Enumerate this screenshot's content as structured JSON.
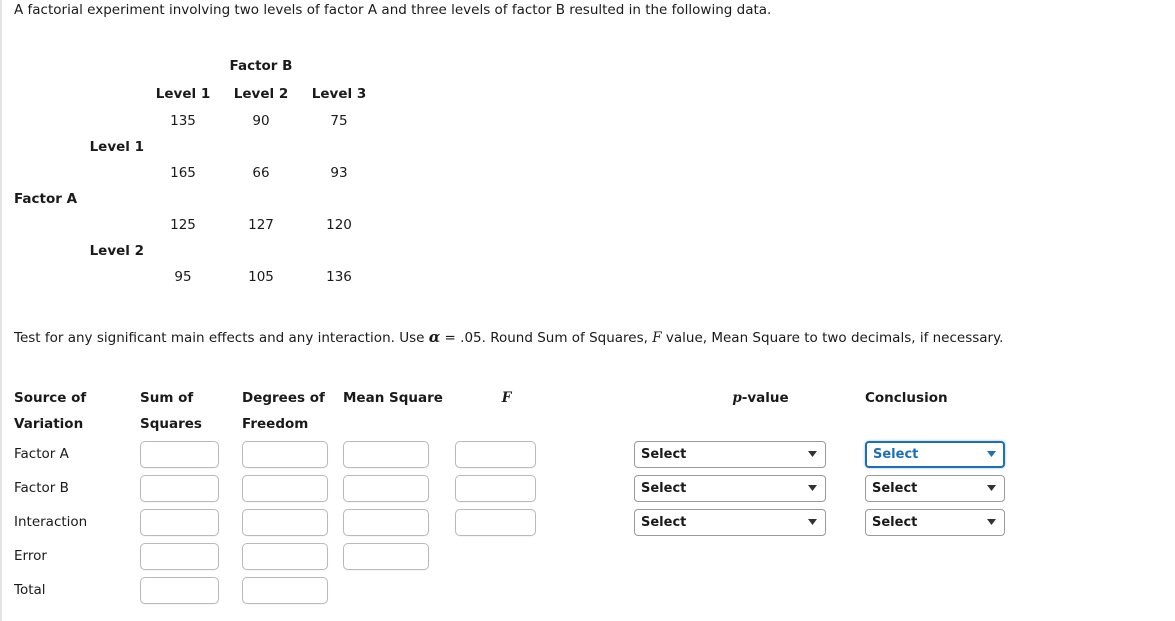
{
  "intro": "A factorial experiment involving two levels of factor A and three levels of factor B resulted in the following data.",
  "data_table": {
    "factor_b_header": "Factor B",
    "b_levels": [
      "Level 1",
      "Level 2",
      "Level 3"
    ],
    "factor_a_label": "Factor A",
    "a_levels": [
      "Level 1",
      "Level 2"
    ],
    "rows": [
      [
        "135",
        "90",
        "75"
      ],
      [
        "165",
        "66",
        "93"
      ],
      [
        "125",
        "127",
        "120"
      ],
      [
        "95",
        "105",
        "136"
      ]
    ]
  },
  "prompt": {
    "part1": "Test for any significant main effects and any interaction. Use ",
    "alpha": "α",
    "part2": " = .05. Round Sum of Squares, ",
    "f": "F",
    "part3": " value, Mean Square to two decimals, if necessary."
  },
  "anova": {
    "headers": {
      "source_line1": "Source of",
      "source_line2": "Variation",
      "ss_line1": "Sum of",
      "ss_line2": "Squares",
      "df_line1": "Degrees of",
      "df_line2": "Freedom",
      "ms": "Mean Square",
      "f": "F",
      "p_italic": "p",
      "p_rest": "-value",
      "conclusion": "Conclusion"
    },
    "rows": [
      {
        "source": "Factor A",
        "ss": "",
        "ss_placeholder": "",
        "df": "",
        "df_placeholder": "",
        "ms": "",
        "ms_placeholder": "",
        "fval": "",
        "f_placeholder": "",
        "pvalue": "Select",
        "conclusion": "Select"
      },
      {
        "source": "Factor B",
        "ss": "",
        "ss_placeholder": "",
        "df": "",
        "df_placeholder": "",
        "ms": "",
        "ms_placeholder": "",
        "fval": "",
        "f_placeholder": "",
        "pvalue": "Select",
        "conclusion": "Select"
      },
      {
        "source": "Interaction",
        "ss": "",
        "ss_placeholder": "",
        "df": "",
        "df_placeholder": "",
        "ms": "",
        "ms_placeholder": "",
        "fval": "",
        "f_placeholder": "",
        "pvalue": "Select",
        "conclusion": "Select"
      },
      {
        "source": "Error",
        "ss": "",
        "ss_placeholder": "",
        "df": "",
        "df_placeholder": "",
        "ms": "",
        "ms_placeholder": "",
        "fval": null,
        "pvalue": null,
        "conclusion": null
      },
      {
        "source": "Total",
        "ss": "",
        "ss_placeholder": "",
        "df": "",
        "df_placeholder": "",
        "ms": null,
        "fval": null,
        "pvalue": null,
        "conclusion": null
      }
    ],
    "focus_accent": "#1c6fb8"
  }
}
